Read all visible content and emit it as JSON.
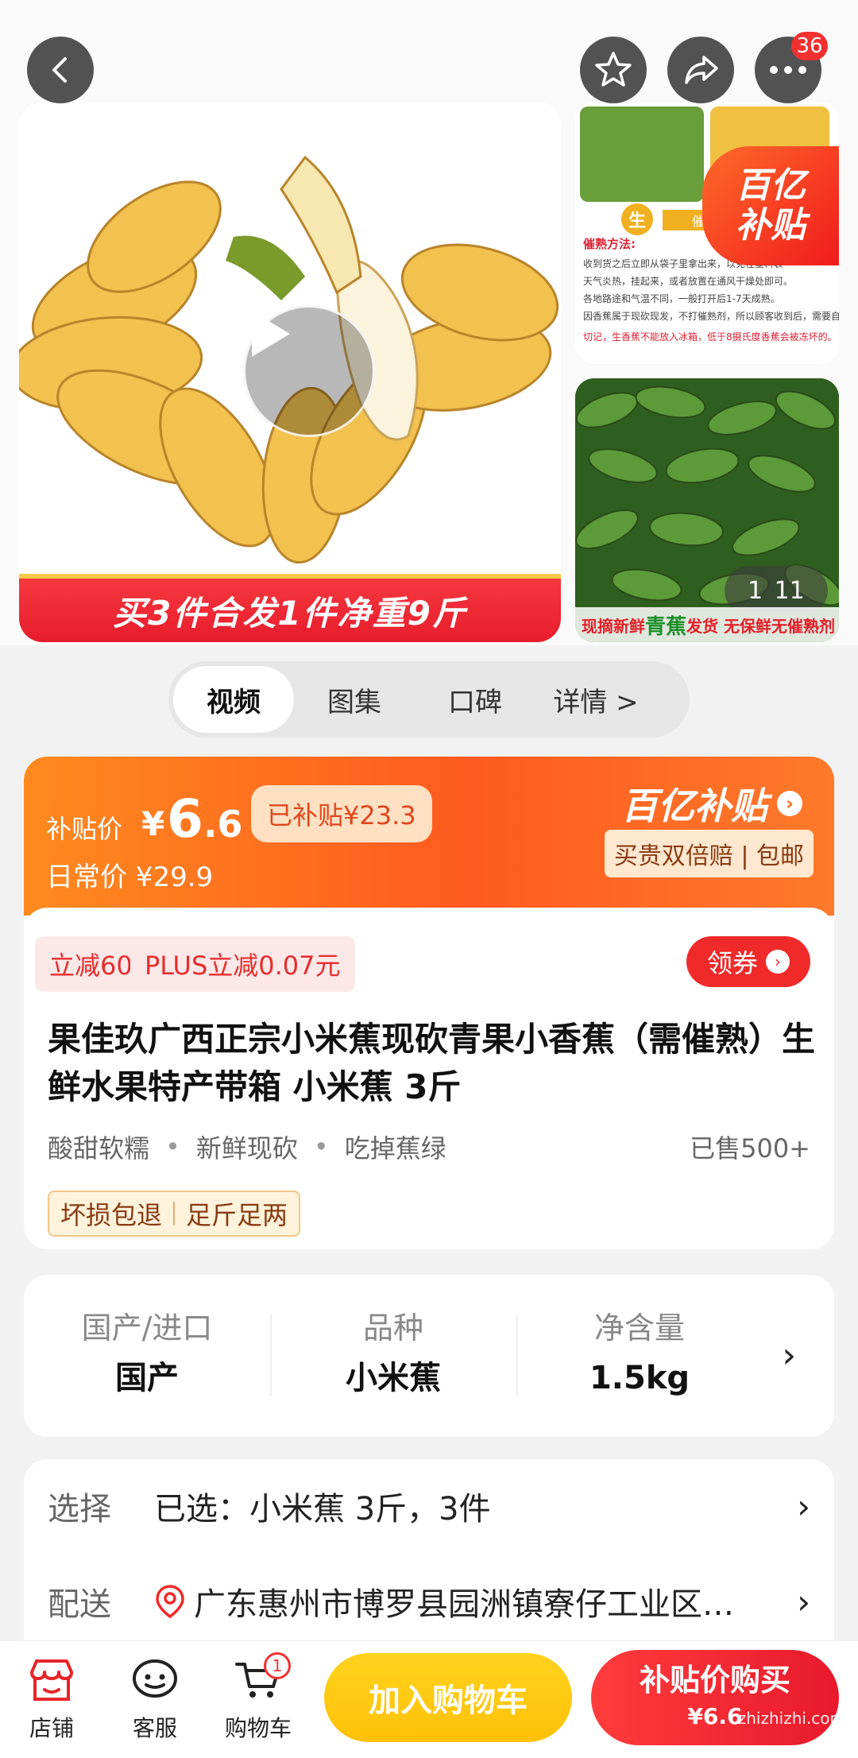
{
  "header": {
    "back_icon": "chevron-left-icon",
    "favorite_icon": "star-icon",
    "share_icon": "share-icon",
    "more_icon": "more-dots-icon",
    "more_badge": "36"
  },
  "gallery": {
    "main_caption": "买3件合发1件净重9斤",
    "side_top_title": "催熟方法:",
    "side_top_notes": [
      "收到货之后立即从袋子里拿出来，以免在塑料袋",
      "天气炎热，挂起来，或者放置在通风干燥处即可。",
      "各地路途和气温不同，一般打开后1-7天成熟。",
      "因香蕉属于现砍现发，不打催熟剂，所以顾客收到后，需要自行催熟。",
      "切记，生香蕉不能放入冰箱，低于8摄氏度香蕉会被冻坏的。"
    ],
    "side_top_tag": "生",
    "side_top_tag2": "催",
    "subsidy_badge_line1": "百亿",
    "subsidy_badge_line2": "补贴",
    "side_bottom_caption_a": "现摘新鲜",
    "side_bottom_caption_hl": "青蕉",
    "side_bottom_caption_b": "发货 无保鲜无催熟剂",
    "counter_current": "1",
    "counter_total": "11"
  },
  "tabs": [
    "视频",
    "图集",
    "口碑",
    "详情 >"
  ],
  "price": {
    "label": "补贴价",
    "yen": "¥",
    "value_int": "6",
    "value_dec": ".6",
    "subsidized": "已补贴¥23.3",
    "daily": "日常价 ¥29.9",
    "brand": "百亿补贴",
    "brand_arrow": "›",
    "tag": "买贵双倍赔 | 包邮"
  },
  "product": {
    "coupon1": "立减60",
    "coupon2": "PLUS立减0.07元",
    "get_coupon": "领券",
    "get_coupon_arrow": "›",
    "title": "果佳玖广西正宗小米蕉现砍青果小香蕉（需催熟）生鲜水果特产带箱 小米蕉 3斤",
    "features": [
      "酸甜软糯",
      "新鲜现砍",
      "吃掉蕉绿"
    ],
    "feature_dot": "•",
    "sold": "已售500+",
    "guarantee1": "坏损包退",
    "guarantee2": "足斤足两"
  },
  "specs": [
    {
      "k": "国产/进口",
      "v": "国产"
    },
    {
      "k": "品种",
      "v": "小米蕉"
    },
    {
      "k": "净含量",
      "v": "1.5kg"
    }
  ],
  "spec_arrow": "›",
  "options": {
    "select_label": "选择",
    "select_value": "已选：小米蕉 3斤，3件",
    "ship_label": "配送",
    "ship_value": "广东惠州市博罗县园洲镇寮仔工业区…",
    "chev": "›"
  },
  "bottom": {
    "shop": "店铺",
    "service": "客服",
    "cart": "购物车",
    "cart_badge": "1",
    "add_cart": "加入购物车",
    "buy_line1": "补贴价购买",
    "buy_line2": "¥6.6",
    "watermark": "zhizhizhi.com"
  },
  "colors": {
    "accent_red": "#f02a2a",
    "accent_orange": "#ff6a1f",
    "cart_yellow": "#ffc107"
  }
}
